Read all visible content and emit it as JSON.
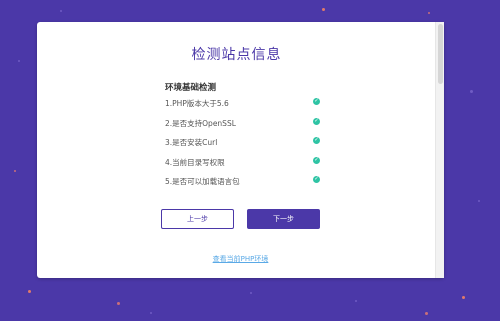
{
  "page": {
    "title": "检测站点信息",
    "section_heading": "环境基础检测",
    "checks": [
      {
        "label": "1.PHP版本大于5.6",
        "status": "passed",
        "icon": "check-circle-icon"
      },
      {
        "label": "2.是否支持OpenSSL",
        "status": "passed",
        "icon": "check-circle-icon"
      },
      {
        "label": "3.是否安装Curl",
        "status": "passed",
        "icon": "check-circle-icon"
      },
      {
        "label": "4.当前目录写权限",
        "status": "passed",
        "icon": "check-circle-icon"
      },
      {
        "label": "5.是否可以加载语言包",
        "status": "passed",
        "icon": "check-circle-icon"
      }
    ],
    "buttons": {
      "prev_label": "上一步",
      "next_label": "下一步"
    },
    "env_link_label": "查看当前PHP环境"
  },
  "colors": {
    "background": "#4b38a8",
    "accent": "#4b38a8",
    "success": "#2ec4a4",
    "link": "#5aa9e6"
  }
}
